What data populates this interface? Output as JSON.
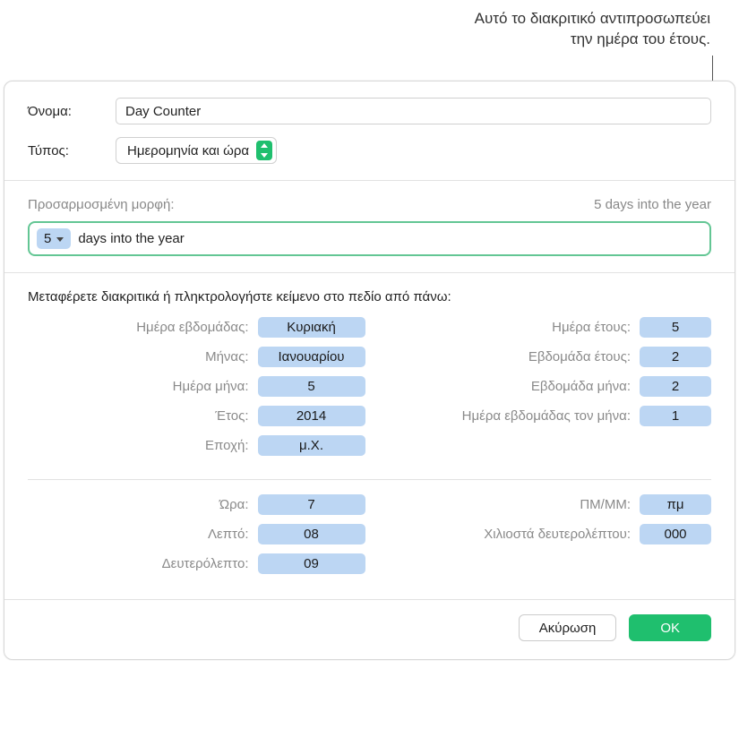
{
  "callout": {
    "line1": "Αυτό το διακριτικό αντιπροσωπεύει",
    "line2": "την ημέρα του έτους."
  },
  "header": {
    "name_label": "Όνομα:",
    "name_value": "Day Counter",
    "type_label": "Τύπος:",
    "type_value": "Ημερομηνία και ώρα"
  },
  "format": {
    "label": "Προσαρμοσμένη μορφή:",
    "preview": "5 days into the year",
    "token_value": "5",
    "trailing_text": "days into the year"
  },
  "tokens": {
    "instruction": "Μεταφέρετε διακριτικά ή πληκτρολογήστε κείμενο στο πεδίο από πάνω:",
    "left": [
      {
        "label": "Ημέρα εβδομάδας:",
        "value": "Κυριακή"
      },
      {
        "label": "Μήνας:",
        "value": "Ιανουαρίου"
      },
      {
        "label": "Ημέρα μήνα:",
        "value": "5"
      },
      {
        "label": "Έτος:",
        "value": "2014"
      },
      {
        "label": "Εποχή:",
        "value": "μ.Χ."
      }
    ],
    "right": [
      {
        "label": "Ημέρα έτους:",
        "value": "5"
      },
      {
        "label": "Εβδομάδα έτους:",
        "value": "2"
      },
      {
        "label": "Εβδομάδα μήνα:",
        "value": "2"
      },
      {
        "label": "Ημέρα εβδομάδας τον μήνα:",
        "value": "1"
      }
    ],
    "time_left": [
      {
        "label": "Ώρα:",
        "value": "7"
      },
      {
        "label": "Λεπτό:",
        "value": "08"
      },
      {
        "label": "Δευτερόλεπτο:",
        "value": "09"
      }
    ],
    "time_right": [
      {
        "label": "ΠΜ/ΜΜ:",
        "value": "πμ"
      },
      {
        "label": "Χιλιοστά δευτερολέπτου:",
        "value": "000"
      }
    ]
  },
  "footer": {
    "cancel": "Ακύρωση",
    "ok": "OK"
  }
}
